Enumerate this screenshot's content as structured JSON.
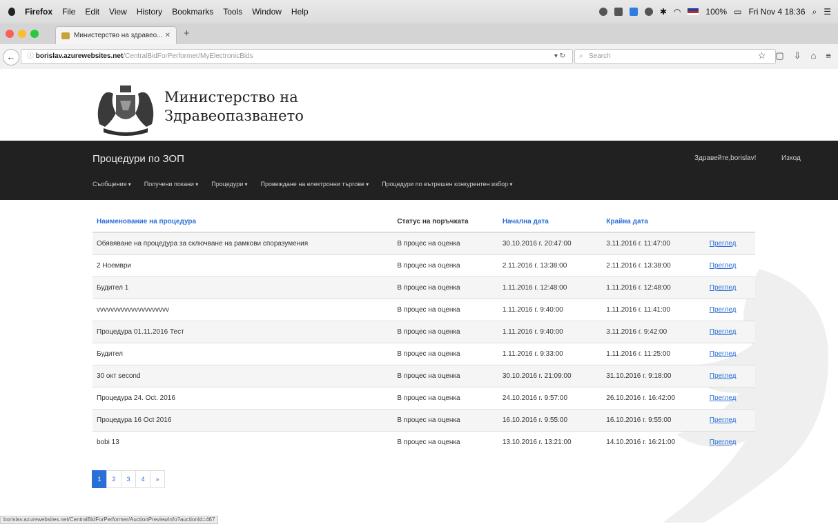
{
  "menubar": {
    "app": "Firefox",
    "items": [
      "File",
      "Edit",
      "View",
      "History",
      "Bookmarks",
      "Tools",
      "Window",
      "Help"
    ],
    "battery": "100%",
    "datetime": "Fri Nov 4  18:36"
  },
  "browser": {
    "tab_title": "Министерство на здравео...",
    "url_host": "borislav.azurewebsites.net",
    "url_path": "/CentralBidForPerformer/MyElectronicBids",
    "search_placeholder": "Search"
  },
  "site": {
    "brand_line1": "Министерство на",
    "brand_line2": "Здравеопазването",
    "title": "Процедури по ЗОП",
    "greeting": "Здравейте,borislav!",
    "logout": "Изход",
    "nav": [
      "Съобщения",
      "Получени покани",
      "Процедури",
      "Провеждане на електронни търгове",
      "Процедури по вътрешен конкурентен избор"
    ]
  },
  "table": {
    "headers": [
      "Наименование на процедура",
      "Статус на поръчката",
      "Начална дата",
      "Крайна дата"
    ],
    "rows": [
      {
        "name": "Обявяване на процедура за сключване на рамкови споразумения",
        "status": "В процес на оценка",
        "start": "30.10.2016 г. 20:47:00",
        "end": "3.11.2016 г. 11:47:00",
        "action": "Преглед"
      },
      {
        "name": "2 Ноември",
        "status": "В процес на оценка",
        "start": "2.11.2016 г. 13:38:00",
        "end": "2.11.2016 г. 13:38:00",
        "action": "Преглед"
      },
      {
        "name": "Будител 1",
        "status": "В процес на оценка",
        "start": "1.11.2016 г. 12:48:00",
        "end": "1.11.2016 г. 12:48:00",
        "action": "Преглед"
      },
      {
        "name": "vvvvvvvvvvvvvvvvvvvvv",
        "status": "В процес на оценка",
        "start": "1.11.2016 г. 9:40:00",
        "end": "1.11.2016 г. 11:41:00",
        "action": "Преглед"
      },
      {
        "name": "Процедура 01.11.2016 Тест",
        "status": "В процес на оценка",
        "start": "1.11.2016 г. 9:40:00",
        "end": "3.11.2016 г. 9:42:00",
        "action": "Преглед"
      },
      {
        "name": "Будител",
        "status": "В процес на оценка",
        "start": "1.11.2016 г. 9:33:00",
        "end": "1.11.2016 г. 11:25:00",
        "action": "Преглед"
      },
      {
        "name": "30 окт second",
        "status": "В процес на оценка",
        "start": "30.10.2016 г. 21:09:00",
        "end": "31.10.2016 г. 9:18:00",
        "action": "Преглед"
      },
      {
        "name": "Процедура 24. Oct. 2016",
        "status": "В процес на оценка",
        "start": "24.10.2016 г. 9:57:00",
        "end": "26.10.2016 г. 16:42:00",
        "action": "Преглед"
      },
      {
        "name": "Процедура 16 Oct 2016",
        "status": "В процес на оценка",
        "start": "16.10.2016 г. 9:55:00",
        "end": "16.10.2016 г. 9:55:00",
        "action": "Преглед"
      },
      {
        "name": "bobi 13",
        "status": "В процес на оценка",
        "start": "13.10.2016 г. 13:21:00",
        "end": "14.10.2016 г. 16:21:00",
        "action": "Преглед"
      }
    ]
  },
  "pagination": [
    "1",
    "2",
    "3",
    "4",
    "»"
  ],
  "status_url": "borislav.azurewebsites.net/CentralBidForPerformer/AuctionPreviewInfo?auctionId=467",
  "colors": {
    "accent": "#2a6fd6",
    "navbar": "#212121"
  }
}
